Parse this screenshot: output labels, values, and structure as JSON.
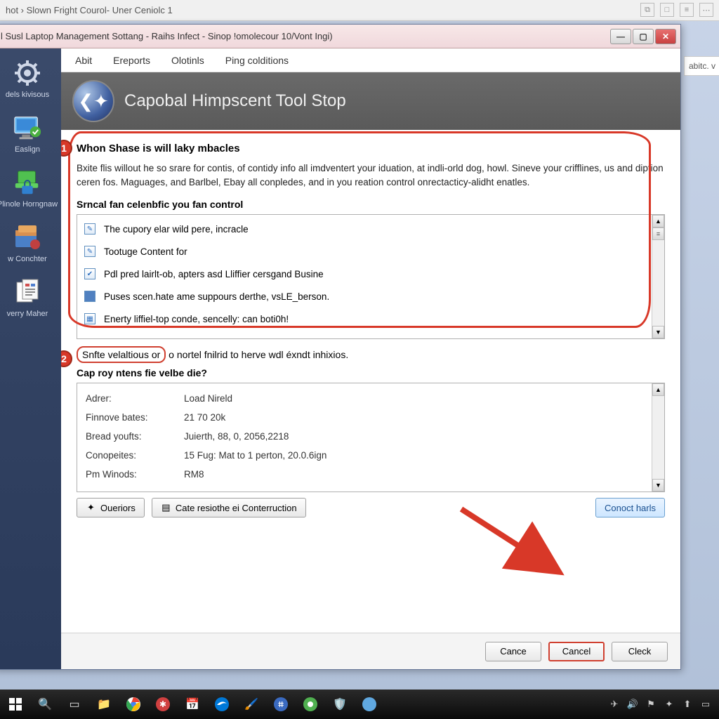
{
  "browser": {
    "breadcrumb": "hot  ›  Slown Fright Courol- Uner Ceniolc 1",
    "right_tab": "abitc. v"
  },
  "dialog": {
    "title": "l Susl Laptop Management Sottang - Raihs Infect - Sinop !omolecour 10/Vont Ingi)"
  },
  "sidebar": {
    "items": [
      {
        "label": "dels kivisous",
        "icon": "gear-icon"
      },
      {
        "label": "Easlign",
        "icon": "monitor-check-icon"
      },
      {
        "label": "Plinole Horngnaw",
        "icon": "laptop-lock-icon"
      },
      {
        "label": "w Conchter",
        "icon": "package-icon"
      },
      {
        "label": "verry Maher",
        "icon": "report-icon"
      }
    ]
  },
  "menubar": {
    "items": [
      "Abit",
      "Ereports",
      "Olotinls",
      "Ping colditions"
    ]
  },
  "header": {
    "title": "Capobal Himpscent Tool Stop"
  },
  "section1": {
    "heading": "Whon Shase is will laky mbacles",
    "body": "Bxite flis willout he so srare for contis, of contidy info all imdventert your iduation, at indli-orld dog, howl. Sineve your crifflines, us and diption ceren fos. Maguages, and Barlbel, Ebay all conpledes, and in you reation control onrectacticy-alidht enatles.",
    "sub_heading": "Srncal fan celenbfic you fan control",
    "list": [
      "The cupory elar wild pere, incracle",
      "Tootuge Content for",
      "Pdl pred lairlt-ob, apters asd Lliffier cersgand Busine",
      "Puses scen.hate ame suppours derthe, vsLE_berson.",
      "Enerty liffiel-top conde, sencelly: can boti0h!"
    ]
  },
  "section2": {
    "line_boxed": "Snfte velaltious or",
    "line_rest": " o nortel fnilrid to herve wdl éxndt inhixios.",
    "details_heading": "Cap roy ntens fie velbe die?",
    "details": [
      {
        "label": "Adrer:",
        "value": "Load Nireld"
      },
      {
        "label": "Finnove bates:",
        "value": "21 70 20k"
      },
      {
        "label": "Bread youfts:",
        "value": "Juierth, 88, 0, 2056,2218"
      },
      {
        "label": "Conopeites:",
        "value": "15 Fug: Mat to 1 perton, 20.0.6ign"
      },
      {
        "label": "Pm Winods:",
        "value": "RM8"
      }
    ],
    "buttons": {
      "queries": "Oueriors",
      "construct": "Cate resiothe ei Conterruction",
      "connect": "Conoct harls"
    }
  },
  "footer": {
    "cance": "Cance",
    "cancel": "Cancel",
    "cleck": "Cleck"
  }
}
